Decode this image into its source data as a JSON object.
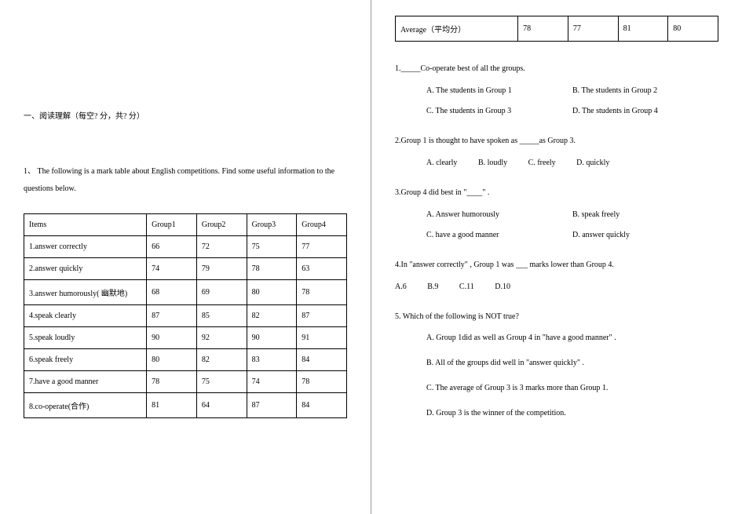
{
  "section_title": "一、阅读理解（每空?  分，共?  分）",
  "question_intro": "1、  The following is a mark table about English competitions. Find some useful information to the questions below.",
  "table": {
    "headers": [
      "Items",
      "Group1",
      "Group2",
      "Group3",
      "Group4"
    ],
    "rows": [
      [
        "1.answer correctly",
        "66",
        "72",
        "75",
        "77"
      ],
      [
        "2.answer quickly",
        "74",
        "79",
        "78",
        "63"
      ],
      [
        "3.answer humorously( 幽默地)",
        "68",
        "69",
        "80",
        "78"
      ],
      [
        "4.speak clearly",
        "87",
        "85",
        "82",
        "87"
      ],
      [
        "5.speak loudly",
        "90",
        "92",
        "90",
        "91"
      ],
      [
        "6.speak freely",
        "80",
        "82",
        "83",
        "84"
      ],
      [
        "7.have a good manner",
        "78",
        "75",
        "74",
        "78"
      ],
      [
        "8.co-operate(合作)",
        "81",
        "64",
        "87",
        "84"
      ]
    ]
  },
  "avg_row": {
    "label": "Average（平均分）",
    "values": [
      "78",
      "77",
      "81",
      "80"
    ]
  },
  "questions": {
    "q1": {
      "stem": "1._____Co-operate best of all the groups.",
      "optA": "A. The students in Group 1",
      "optB": "B. The students in Group 2",
      "optC": "C. The students in Group 3",
      "optD": "D. The students in Group 4"
    },
    "q2": {
      "stem": "2.Group 1 is thought to have spoken as  _____as Group 3.",
      "optA": "A. clearly",
      "optB": "B. loudly",
      "optC": "C. freely",
      "optD": "D. quickly"
    },
    "q3": {
      "stem": "3.Group 4 did best in \"____\" .",
      "optA": "A. Answer humorously",
      "optB": "B. speak freely",
      "optC": "C. have a good manner",
      "optD": "D. answer quickly"
    },
    "q4": {
      "stem": "4.In \"answer correctly\" , Group 1 was  ___ marks lower than Group 4.",
      "optA": "A.6",
      "optB": "B.9",
      "optC": "C.11",
      "optD": "D.10"
    },
    "q5": {
      "stem": "5. Which of the following is NOT true?",
      "optA": "A. Group 1did as well as Group 4 in \"have a good manner\" .",
      "optB": "B. All of the groups did well in \"answer quickly\" .",
      "optC": "C. The average of Group 3 is 3 marks more than Group 1.",
      "optD": "D. Group 3 is the winner of the competition."
    }
  }
}
